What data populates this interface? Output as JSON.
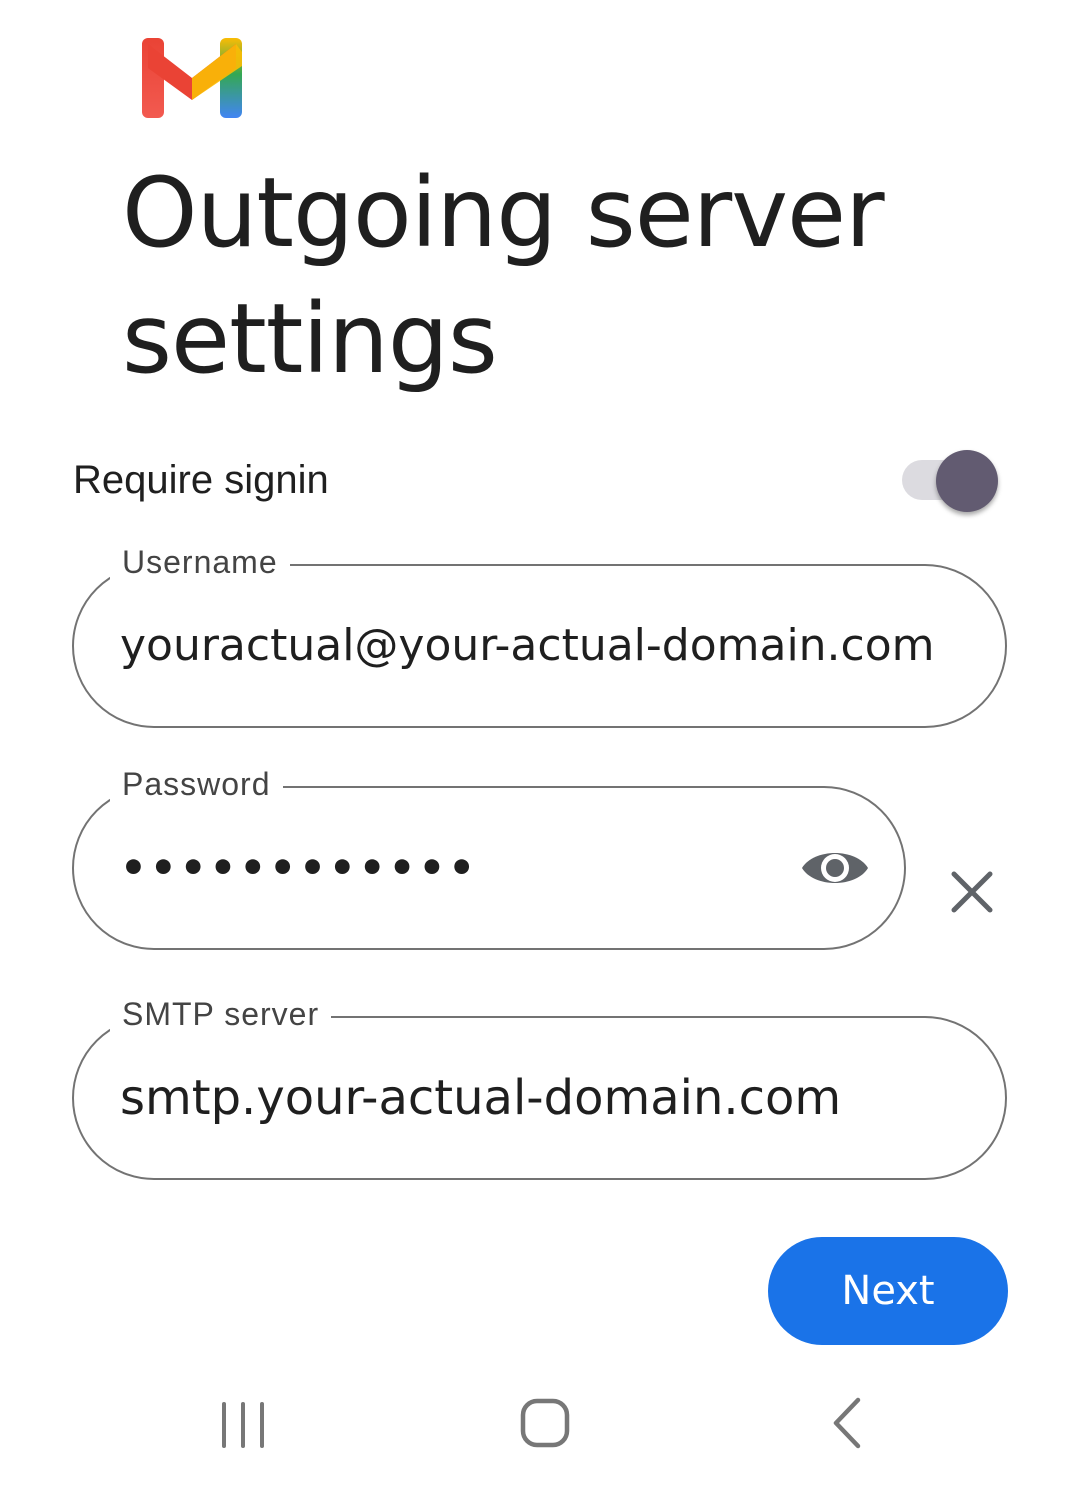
{
  "app": {
    "logo_icon": "gmail-logo-icon",
    "title": "Outgoing server settings"
  },
  "require_signin": {
    "label": "Require signin",
    "enabled": true,
    "toggle_color": "#625b71"
  },
  "fields": {
    "username": {
      "label": "Username",
      "value": "youractual@your-actual-domain.com"
    },
    "password": {
      "label": "Password",
      "masked_value": "••••••••••••",
      "visibility_icon": "eye-icon",
      "clear_icon": "close-icon"
    },
    "smtp_server": {
      "label": "SMTP server",
      "value": "smtp.your-actual-domain.com"
    }
  },
  "actions": {
    "next_label": "Next",
    "accent_color": "#1a73e8"
  },
  "navbar": {
    "recents_icon": "recent-apps-icon",
    "home_icon": "home-icon",
    "back_icon": "back-chevron-icon"
  }
}
